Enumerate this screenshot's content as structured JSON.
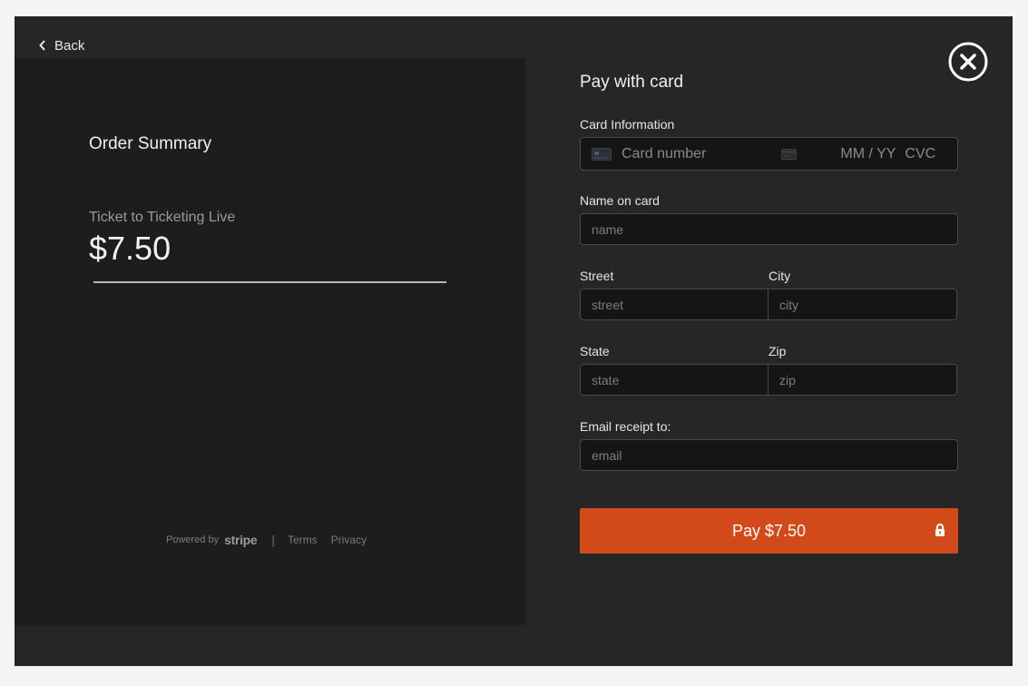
{
  "nav": {
    "back_label": "Back"
  },
  "summary": {
    "title": "Order Summary",
    "item_name": "Ticket to Ticketing Live",
    "price": "$7.50"
  },
  "footer": {
    "powered_by": "Powered by",
    "brand": "stripe",
    "separator": "|",
    "terms": "Terms",
    "privacy": "Privacy"
  },
  "payment": {
    "title": "Pay with card",
    "card_info_label": "Card Information",
    "card_number_placeholder": "Card number",
    "expiry_placeholder": "MM / YY",
    "cvc_placeholder": "CVC",
    "name_label": "Name on card",
    "name_placeholder": "name",
    "street_label": "Street",
    "street_placeholder": "street",
    "city_label": "City",
    "city_placeholder": "city",
    "state_label": "State",
    "state_placeholder": "state",
    "zip_label": "Zip",
    "zip_placeholder": "zip",
    "email_label": "Email receipt to:",
    "email_placeholder": "email",
    "pay_button_label": "Pay $7.50"
  },
  "colors": {
    "modal_bg": "#262626",
    "panel_bg": "#1d1d1d",
    "accent": "#d34a1a"
  },
  "icons": [
    "chevron-left-icon",
    "close-circle-icon",
    "card-icon",
    "card-back-icon",
    "lock-icon"
  ]
}
